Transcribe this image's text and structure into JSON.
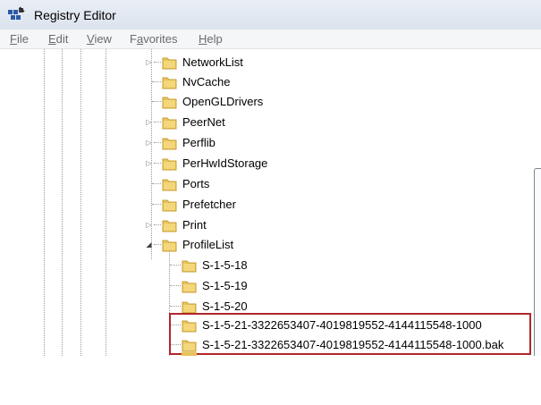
{
  "window": {
    "title": "Registry Editor"
  },
  "menu": {
    "items": [
      {
        "label": "File",
        "accel": "F",
        "rest": "ile"
      },
      {
        "label": "Edit",
        "accel": "E",
        "rest": "dit"
      },
      {
        "label": "View",
        "accel": "V",
        "rest": "iew"
      },
      {
        "label": "Favorites",
        "accel": "a",
        "pre": "F",
        "rest": "vorites"
      },
      {
        "label": "Help",
        "accel": "H",
        "rest": "elp"
      }
    ]
  },
  "tree": {
    "items": [
      {
        "label": "NetworkList",
        "expander": "▷"
      },
      {
        "label": "NvCache",
        "expander": ""
      },
      {
        "label": "OpenGLDrivers",
        "expander": ""
      },
      {
        "label": "PeerNet",
        "expander": "▷"
      },
      {
        "label": "Perflib",
        "expander": "▷"
      },
      {
        "label": "PerHwIdStorage",
        "expander": "▷"
      },
      {
        "label": "Ports",
        "expander": ""
      },
      {
        "label": "Prefetcher",
        "expander": ""
      },
      {
        "label": "Print",
        "expander": "▷"
      },
      {
        "label": "ProfileList",
        "expander": "◢"
      }
    ],
    "children": [
      {
        "label": "S-1-5-18"
      },
      {
        "label": "S-1-5-19"
      },
      {
        "label": "S-1-5-20"
      },
      {
        "label": "S-1-5-21-3322653407-4019819552-4144115548-1000"
      },
      {
        "label": "S-1-5-21-3322653407-4019819552-4144115548-1000.bak"
      }
    ]
  },
  "colors": {
    "highlight_border": "#b3262a",
    "folder": "#e8c35a"
  }
}
